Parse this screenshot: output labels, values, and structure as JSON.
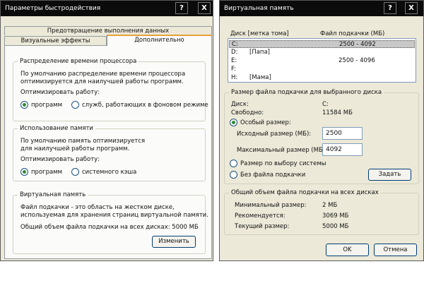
{
  "perf": {
    "title": "Параметры быстродействия",
    "help": "?",
    "close": "X",
    "tabs": {
      "dep": "Предотвращение выполнения данных",
      "visual": "Визуальные эффекты",
      "advanced": "Дополнительно"
    },
    "cpu": {
      "heading": "Распределение времени процессора",
      "desc1": "По умолчанию распределение времени процессора",
      "desc2": "оптимизируется для наилучшей работы программ.",
      "optimize": "Оптимизировать работу:",
      "opt1": "программ",
      "opt2": "служб, работающих в фоновом режиме"
    },
    "mem": {
      "heading": "Использование памяти",
      "desc1": "По умолчанию память оптимизируется",
      "desc2": "для наилучшей работы программ.",
      "optimize": "Оптимизировать работу:",
      "opt1": "программ",
      "opt2": "системного кэша"
    },
    "vm": {
      "heading": "Виртуальная память",
      "desc1": "Файл подкачки - это область на жестком диске,",
      "desc2": "используемая для хранения страниц виртуальной памяти.",
      "total": "Общий объем файла подкачки на всех дисках:  5000 МБ",
      "change": "Изменить"
    }
  },
  "vmem": {
    "title": "Виртуальная память",
    "help": "?",
    "close": "X",
    "list": {
      "col_disk": "Диск [метка тома]",
      "col_file": "Файл подкачки (МБ)",
      "rows": [
        {
          "disk": "C:",
          "label": "",
          "size": "2500 - 4092"
        },
        {
          "disk": "D:",
          "label": "[Папа]",
          "size": ""
        },
        {
          "disk": "E:",
          "label": "",
          "size": "2500 - 4096"
        },
        {
          "disk": "F:",
          "label": "",
          "size": ""
        },
        {
          "disk": "H:",
          "label": "[Мама]",
          "size": ""
        }
      ]
    },
    "sel": {
      "heading": "Размер файла подкачки для выбранного диска",
      "disk_label": "Диск:",
      "disk_value": "C:",
      "free_label": "Свободно:",
      "free_value": "11584 МБ",
      "custom": "Особый размер:",
      "initial_label": "Исходный размер (МБ):",
      "initial_value": "2500",
      "max_label": "Максимальный размер (МБ):",
      "max_value": "4092",
      "system": "Размер по выбору системы",
      "nofile": "Без файла подкачки",
      "set": "Задать"
    },
    "total": {
      "heading": "Общий объем файла подкачки на всех дисках",
      "min_label": "Минимальный размер:",
      "min_value": "2 МБ",
      "rec_label": "Рекомендуется:",
      "rec_value": "3069 МБ",
      "cur_label": "Текущий размер:",
      "cur_value": "5000 МБ"
    },
    "ok": "OK",
    "cancel": "Отмена"
  }
}
